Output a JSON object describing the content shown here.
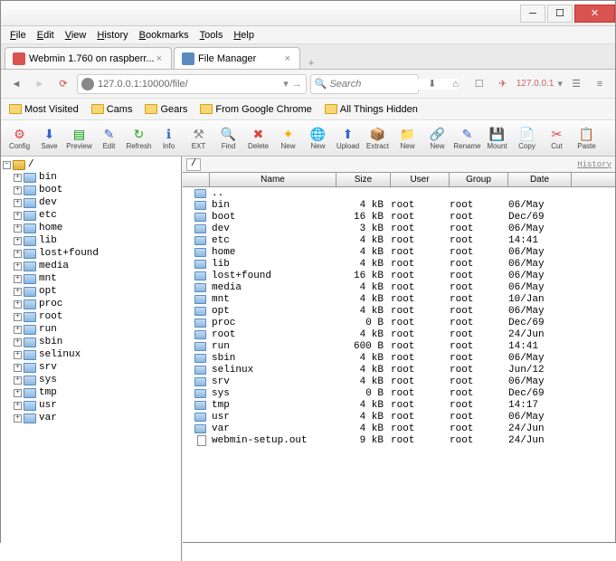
{
  "menubar": [
    "File",
    "Edit",
    "View",
    "History",
    "Bookmarks",
    "Tools",
    "Help"
  ],
  "tabs": [
    {
      "label": "Webmin 1.760 on raspberr...",
      "favicon": "#d9534f",
      "active": false
    },
    {
      "label": "File Manager",
      "favicon": "#5a8bbf",
      "active": true
    }
  ],
  "url": "127.0.0.1:10000/file/",
  "search_placeholder": "Search",
  "ip_badge": "127.0.0.1",
  "bookmarks": [
    "Most Visited",
    "Cams",
    "Gears",
    "From Google Chrome",
    "All Things Hidden"
  ],
  "toolbar": [
    {
      "label": "Config",
      "icon": "⚙",
      "color": "#d44"
    },
    {
      "label": "Save",
      "icon": "⬇",
      "color": "#36c"
    },
    {
      "label": "Preview",
      "icon": "▤",
      "color": "#090"
    },
    {
      "label": "Edit",
      "icon": "✎",
      "color": "#36c"
    },
    {
      "label": "Refresh",
      "icon": "↻",
      "color": "#2a2"
    },
    {
      "label": "Info",
      "icon": "ℹ",
      "color": "#36c"
    },
    {
      "label": "EXT",
      "icon": "⚒",
      "color": "#888"
    },
    {
      "label": "Find",
      "icon": "🔍",
      "color": "#888"
    },
    {
      "label": "Delete",
      "icon": "✖",
      "color": "#d44"
    },
    {
      "label": "New",
      "icon": "✦",
      "color": "#fa0"
    },
    {
      "label": "New",
      "icon": "🌐",
      "color": "#f80"
    },
    {
      "label": "Upload",
      "icon": "⬆",
      "color": "#36c"
    },
    {
      "label": "Extract",
      "icon": "📦",
      "color": "#a62"
    },
    {
      "label": "New",
      "icon": "📁",
      "color": "#fa0"
    },
    {
      "label": "New",
      "icon": "🔗",
      "color": "#fa0"
    },
    {
      "label": "Rename",
      "icon": "✎",
      "color": "#36c"
    },
    {
      "label": "Mount",
      "icon": "💾",
      "color": "#888"
    },
    {
      "label": "Copy",
      "icon": "📄",
      "color": "#aaa"
    },
    {
      "label": "Cut",
      "icon": "✂",
      "color": "#d44"
    },
    {
      "label": "Paste",
      "icon": "📋",
      "color": "#fa0"
    }
  ],
  "tree": [
    {
      "name": "/",
      "root": true,
      "expanded": true,
      "level": 0
    },
    {
      "name": "bin",
      "level": 1
    },
    {
      "name": "boot",
      "level": 1
    },
    {
      "name": "dev",
      "level": 1
    },
    {
      "name": "etc",
      "level": 1
    },
    {
      "name": "home",
      "level": 1
    },
    {
      "name": "lib",
      "level": 1
    },
    {
      "name": "lost+found",
      "level": 1
    },
    {
      "name": "media",
      "level": 1
    },
    {
      "name": "mnt",
      "level": 1
    },
    {
      "name": "opt",
      "level": 1
    },
    {
      "name": "proc",
      "level": 1
    },
    {
      "name": "root",
      "level": 1
    },
    {
      "name": "run",
      "level": 1
    },
    {
      "name": "sbin",
      "level": 1
    },
    {
      "name": "selinux",
      "level": 1
    },
    {
      "name": "srv",
      "level": 1
    },
    {
      "name": "sys",
      "level": 1
    },
    {
      "name": "tmp",
      "level": 1
    },
    {
      "name": "usr",
      "level": 1
    },
    {
      "name": "var",
      "level": 1
    }
  ],
  "current_path": "/",
  "history_label": "History",
  "columns": [
    "",
    "Name",
    "Size",
    "User",
    "Group",
    "Date"
  ],
  "files": [
    {
      "name": "..",
      "size": "",
      "user": "",
      "group": "",
      "date": "",
      "type": "dir"
    },
    {
      "name": "bin",
      "size": "4 kB",
      "user": "root",
      "group": "root",
      "date": "06/May",
      "type": "dir"
    },
    {
      "name": "boot",
      "size": "16 kB",
      "user": "root",
      "group": "root",
      "date": "Dec/69",
      "type": "dir"
    },
    {
      "name": "dev",
      "size": "3 kB",
      "user": "root",
      "group": "root",
      "date": "06/May",
      "type": "dir"
    },
    {
      "name": "etc",
      "size": "4 kB",
      "user": "root",
      "group": "root",
      "date": "14:41",
      "type": "dir"
    },
    {
      "name": "home",
      "size": "4 kB",
      "user": "root",
      "group": "root",
      "date": "06/May",
      "type": "dir"
    },
    {
      "name": "lib",
      "size": "4 kB",
      "user": "root",
      "group": "root",
      "date": "06/May",
      "type": "dir"
    },
    {
      "name": "lost+found",
      "size": "16 kB",
      "user": "root",
      "group": "root",
      "date": "06/May",
      "type": "dir"
    },
    {
      "name": "media",
      "size": "4 kB",
      "user": "root",
      "group": "root",
      "date": "06/May",
      "type": "dir"
    },
    {
      "name": "mnt",
      "size": "4 kB",
      "user": "root",
      "group": "root",
      "date": "10/Jan",
      "type": "dir"
    },
    {
      "name": "opt",
      "size": "4 kB",
      "user": "root",
      "group": "root",
      "date": "06/May",
      "type": "dir"
    },
    {
      "name": "proc",
      "size": "0 B",
      "user": "root",
      "group": "root",
      "date": "Dec/69",
      "type": "dir"
    },
    {
      "name": "root",
      "size": "4 kB",
      "user": "root",
      "group": "root",
      "date": "24/Jun",
      "type": "dir"
    },
    {
      "name": "run",
      "size": "600 B",
      "user": "root",
      "group": "root",
      "date": "14:41",
      "type": "dir"
    },
    {
      "name": "sbin",
      "size": "4 kB",
      "user": "root",
      "group": "root",
      "date": "06/May",
      "type": "dir"
    },
    {
      "name": "selinux",
      "size": "4 kB",
      "user": "root",
      "group": "root",
      "date": "Jun/12",
      "type": "dir"
    },
    {
      "name": "srv",
      "size": "4 kB",
      "user": "root",
      "group": "root",
      "date": "06/May",
      "type": "dir"
    },
    {
      "name": "sys",
      "size": "0 B",
      "user": "root",
      "group": "root",
      "date": "Dec/69",
      "type": "dir"
    },
    {
      "name": "tmp",
      "size": "4 kB",
      "user": "root",
      "group": "root",
      "date": "14:17",
      "type": "dir"
    },
    {
      "name": "usr",
      "size": "4 kB",
      "user": "root",
      "group": "root",
      "date": "06/May",
      "type": "dir"
    },
    {
      "name": "var",
      "size": "4 kB",
      "user": "root",
      "group": "root",
      "date": "24/Jun",
      "type": "dir"
    },
    {
      "name": "webmin-setup.out",
      "size": "9 kB",
      "user": "root",
      "group": "root",
      "date": "24/Jun",
      "type": "file"
    }
  ]
}
